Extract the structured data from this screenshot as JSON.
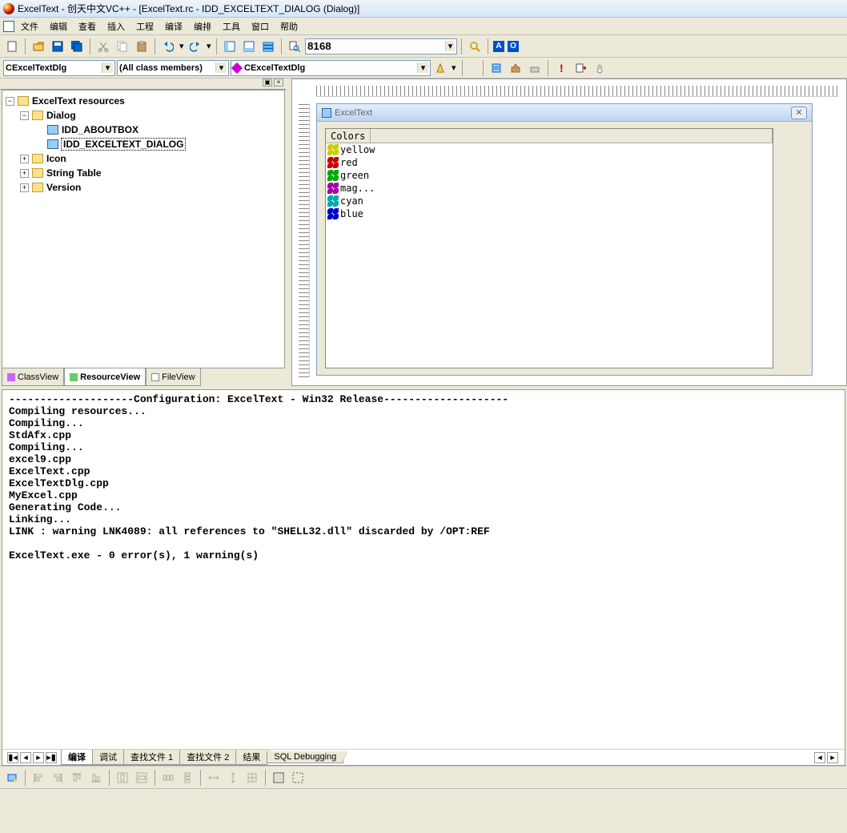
{
  "title": "ExcelText - 创天中文VC++ - [ExcelText.rc - IDD_EXCELTEXT_DIALOG (Dialog)]",
  "menu": {
    "items": [
      "文件",
      "编辑",
      "查看",
      "插入",
      "工程",
      "编译",
      "编排",
      "工具",
      "窗口",
      "帮助"
    ]
  },
  "toolbar": {
    "search_value": "8168",
    "a_label": "A",
    "o_label": "O"
  },
  "wizard": {
    "class_sel": "CExcelTextDlg",
    "members_sel": "(All class members)",
    "func_sel": "CExcelTextDlg"
  },
  "tree": {
    "root": "ExcelText resources",
    "dialog": "Dialog",
    "dlg_about": "IDD_ABOUTBOX",
    "dlg_main": "IDD_EXCELTEXT_DIALOG",
    "icon": "Icon",
    "strtbl": "String Table",
    "version": "Version"
  },
  "left_tabs": {
    "class": "ClassView",
    "res": "ResourceView",
    "file": "FileView"
  },
  "design": {
    "title": "ExcelText",
    "col_header": "Colors",
    "rows": [
      {
        "label": "yellow",
        "color": "#cccc00"
      },
      {
        "label": "red",
        "color": "#cc0000"
      },
      {
        "label": "green",
        "color": "#00aa00"
      },
      {
        "label": "mag...",
        "color": "#aa00aa"
      },
      {
        "label": "cyan",
        "color": "#00aaaa"
      },
      {
        "label": "blue",
        "color": "#0000cc"
      }
    ]
  },
  "output": {
    "lines": "--------------------Configuration: ExcelText - Win32 Release--------------------\nCompiling resources...\nCompiling...\nStdAfx.cpp\nCompiling...\nexcel9.cpp\nExcelText.cpp\nExcelTextDlg.cpp\nMyExcel.cpp\nGenerating Code...\nLinking...\nLINK : warning LNK4089: all references to \"SHELL32.dll\" discarded by /OPT:REF\n\nExcelText.exe - 0 error(s), 1 warning(s)\n",
    "tabs": [
      "编译",
      "调试",
      "查找文件 1",
      "查找文件 2",
      "结果",
      "SQL Debugging"
    ]
  }
}
